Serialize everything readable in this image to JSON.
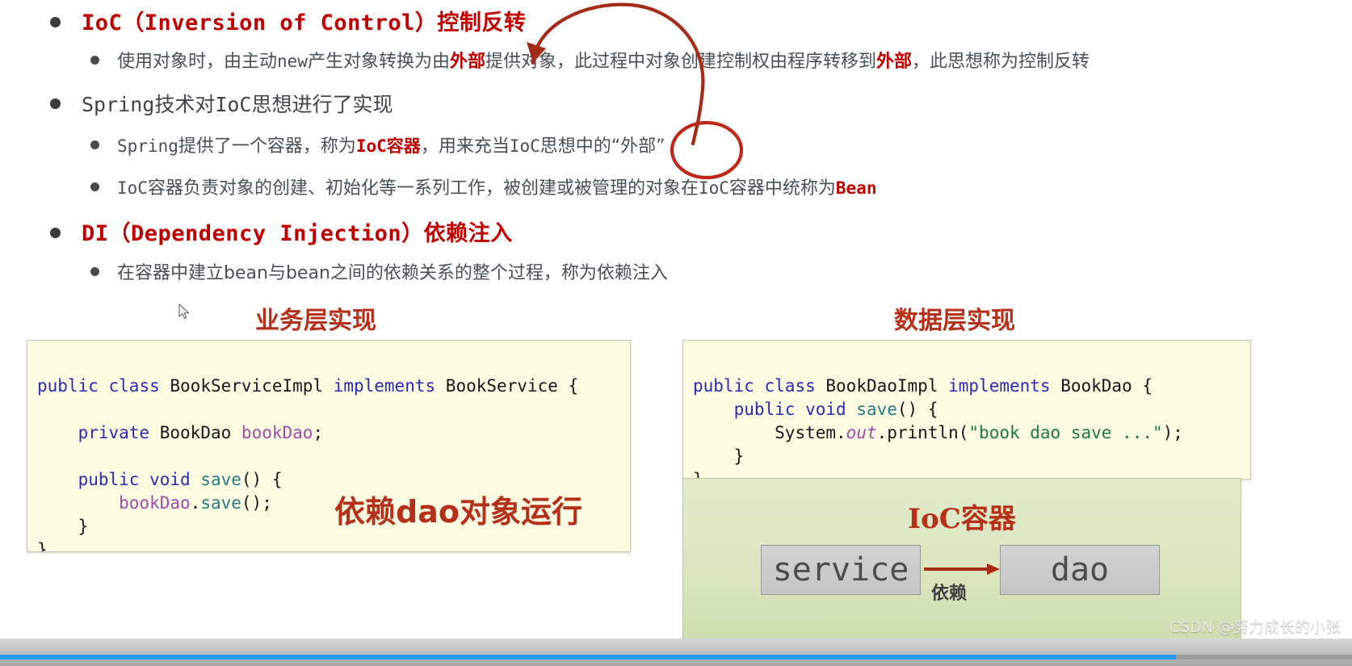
{
  "slide": {
    "bullets": [
      {
        "level": 1,
        "style": "heading",
        "text": "IoC（Inversion of Control）控制反转",
        "parts": [
          {
            "t": "IoC",
            "k": "mono"
          },
          {
            "t": "（Inversion of Control）",
            "k": "mono"
          },
          {
            "t": "控制反转",
            "k": "cjk"
          }
        ]
      },
      {
        "level": 2,
        "text": "使用对象时，由主动new产生对象转换为由外部提供对象，此过程中对象创建控制权由程序转移到外部，此思想称为控制反转",
        "parts": [
          {
            "t": "使用对象时，由主动",
            "k": "plain"
          },
          {
            "t": "new",
            "k": "mono"
          },
          {
            "t": "产生对象转换为由",
            "k": "plain"
          },
          {
            "t": "外部",
            "k": "red"
          },
          {
            "t": "提供对象，此过程中对象创建控制权由程序转移到",
            "k": "plain"
          },
          {
            "t": "外部",
            "k": "red"
          },
          {
            "t": "，此思想称为控制反转",
            "k": "plain"
          }
        ]
      },
      {
        "level": 1,
        "style": "plain",
        "text": "Spring技术对IoC思想进行了实现",
        "parts": [
          {
            "t": "Spring",
            "k": "mono"
          },
          {
            "t": "技术对",
            "k": "cjk"
          },
          {
            "t": "IoC",
            "k": "mono"
          },
          {
            "t": "思想进行了实现",
            "k": "cjk"
          }
        ]
      },
      {
        "level": 2,
        "text": "Spring提供了一个容器，称为IoC容器，用来充当IoC思想中的“外部”",
        "parts": [
          {
            "t": "Spring",
            "k": "mono"
          },
          {
            "t": "提供了一个容器，称为",
            "k": "plain"
          },
          {
            "t": "IoC容器",
            "k": "redmono"
          },
          {
            "t": "，用来充当",
            "k": "plain"
          },
          {
            "t": "IoC",
            "k": "mono"
          },
          {
            "t": "思想中的“外部”",
            "k": "plain"
          }
        ]
      },
      {
        "level": 2,
        "text": "IoC容器负责对象的创建、初始化等一系列工作，被创建或被管理的对象在IoC容器中统称为Bean",
        "parts": [
          {
            "t": "IoC",
            "k": "mono"
          },
          {
            "t": "容器负责对象的创建、初始化等一系列工作，被创建或被管理的对象在",
            "k": "plain"
          },
          {
            "t": "IoC",
            "k": "mono"
          },
          {
            "t": "容器中统称为",
            "k": "plain"
          },
          {
            "t": "Bean",
            "k": "redmono"
          }
        ]
      },
      {
        "level": 1,
        "style": "heading",
        "text": "DI（Dependency Injection）依赖注入",
        "parts": [
          {
            "t": "DI",
            "k": "mono"
          },
          {
            "t": "（Dependency Injection）",
            "k": "mono"
          },
          {
            "t": "依赖注入",
            "k": "cjk"
          }
        ]
      },
      {
        "level": 2,
        "text": "在容器中建立bean与bean之间的依赖关系的整个过程，称为依赖注入",
        "parts": [
          {
            "t": "在容器中建立",
            "k": "plain"
          },
          {
            "t": "bean",
            "k": "plain"
          },
          {
            "t": "与",
            "k": "plain"
          },
          {
            "t": "bean",
            "k": "plain"
          },
          {
            "t": "之间的依赖关系的整个过程，称为依赖注入",
            "k": "plain"
          }
        ]
      }
    ],
    "captions": {
      "service_layer": "业务层实现",
      "data_layer": "数据层实现"
    },
    "code_service": {
      "title": "业务层实现",
      "lines": [
        "public class BookServiceImpl implements BookService {",
        "",
        "    private BookDao bookDao;",
        "",
        "    public void save() {",
        "        bookDao.save();",
        "    }",
        "}"
      ]
    },
    "code_dao": {
      "title": "数据层实现",
      "lines": [
        "public class BookDaoImpl implements BookDao {",
        "    public void save() {",
        "        System.out.println(\"book dao save ...\");",
        "    }",
        "}"
      ]
    },
    "code_note": "依赖dao对象运行",
    "ioc_diagram": {
      "title": "IoC容器",
      "node_left": "service",
      "node_right": "dao",
      "arrow_label": "依赖"
    },
    "watermark": "CSDN @努力成长的小张",
    "progress_percent": 87,
    "colors": {
      "accent_red": "#c00000",
      "caption_red": "#b5311b",
      "code_bg": "#fbfbe2",
      "container_green": "#dbe6bf",
      "progress_blue": "#1f9cf0"
    }
  }
}
